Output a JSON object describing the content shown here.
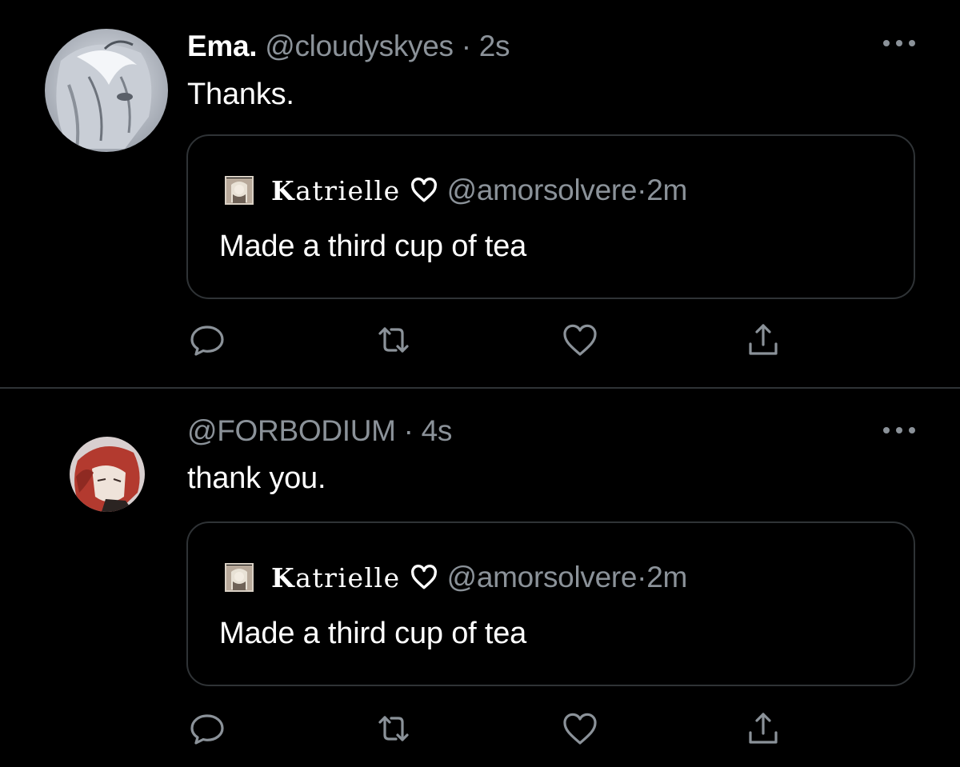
{
  "tweets": [
    {
      "display_name": "Ema.",
      "handle": "@cloudyskyes",
      "separator": "·",
      "time": "2s",
      "text": "Thanks.",
      "quote": {
        "name_initial": "K",
        "name_rest": "atrielle",
        "handle": "@amorsolvere",
        "separator": "·",
        "time": "2m",
        "text": "Made a third cup of tea"
      }
    },
    {
      "display_name": "",
      "handle": "@FORBODIUM",
      "separator": "·",
      "time": "4s",
      "text": "thank you.",
      "quote": {
        "name_initial": "K",
        "name_rest": "atrielle",
        "handle": "@amorsolvere",
        "separator": "·",
        "time": "2m",
        "text": "Made a third cup of tea"
      }
    }
  ],
  "icons": {
    "more": "more-horizontal-icon",
    "reply": "reply-icon",
    "retweet": "retweet-icon",
    "like": "heart-icon",
    "share": "share-icon"
  },
  "colors": {
    "background": "#000000",
    "text": "#ffffff",
    "secondary": "#8b9299",
    "border": "#2f3336"
  }
}
